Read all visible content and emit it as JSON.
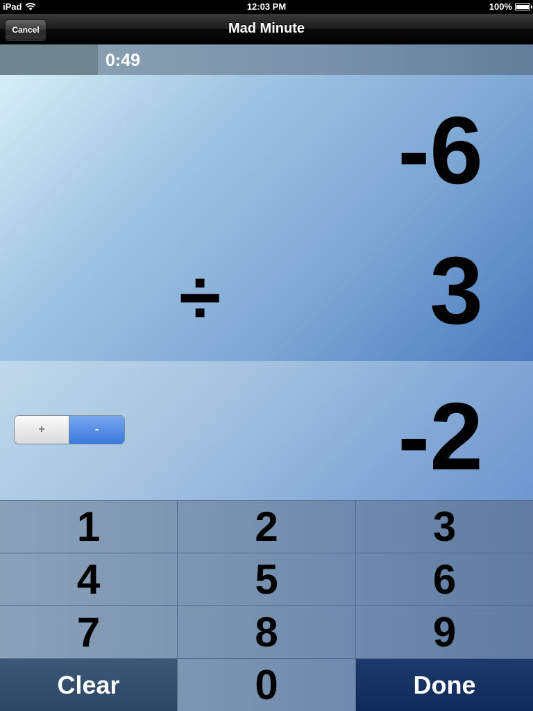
{
  "status_bar": {
    "device": "iPad",
    "time": "12:03 PM",
    "battery": "100%"
  },
  "nav": {
    "title": "Mad Minute",
    "cancel_label": "Cancel"
  },
  "timer": {
    "time_remaining": "0:49"
  },
  "problem": {
    "top_operand": "-6",
    "operator": "÷",
    "bottom_operand": "3"
  },
  "answer": {
    "value": "-2",
    "sign_plus_label": "+",
    "sign_minus_label": "-",
    "selected_sign": "-"
  },
  "keypad": {
    "keys": [
      "1",
      "2",
      "3",
      "4",
      "5",
      "6",
      "7",
      "8",
      "9",
      "Clear",
      "0",
      "Done"
    ]
  },
  "colors": {
    "done_key": "#0e2a58",
    "clear_key": "#2c4564",
    "sign_selected": "#3a78dd"
  }
}
